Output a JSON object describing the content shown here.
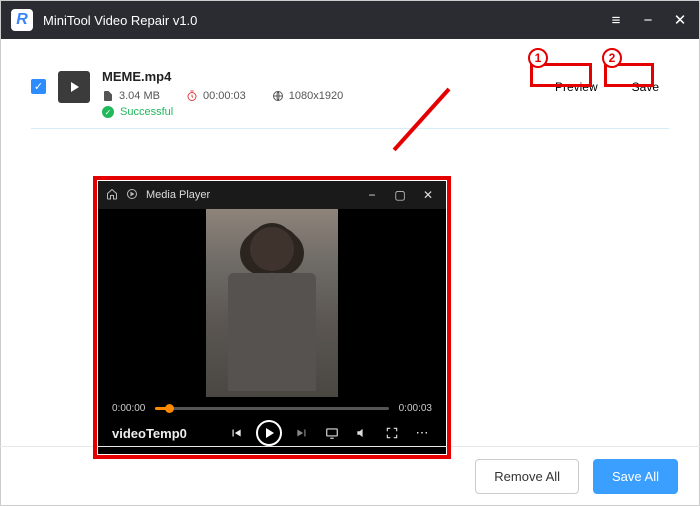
{
  "app": {
    "title": "MiniTool Video Repair v1.0",
    "logo_letter": "R"
  },
  "file": {
    "name": "MEME.mp4",
    "size": "3.04 MB",
    "duration": "00:00:03",
    "resolution": "1080x1920",
    "status": "Successful"
  },
  "actions": {
    "preview": "Preview",
    "save": "Save"
  },
  "annotations": {
    "step1": "1",
    "step2": "2"
  },
  "player": {
    "title": "Media Player",
    "file_label": "videoTemp0",
    "time_current": "0:00:00",
    "time_total": "0:00:03"
  },
  "footer": {
    "remove_all": "Remove All",
    "save_all": "Save All"
  }
}
